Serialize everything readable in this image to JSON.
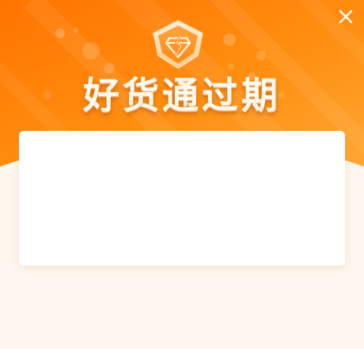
{
  "dialog": {
    "title": "好货通过期",
    "colors": {
      "header_gradient_start": "#ff7a00",
      "header_gradient_end": "#ffab3a",
      "page_background": "#fdf7ef",
      "card_background": "#ffffff",
      "title_text": "#fff8ee"
    },
    "icons": {
      "badge": "diamond-shield-icon",
      "close": "close-icon"
    }
  }
}
